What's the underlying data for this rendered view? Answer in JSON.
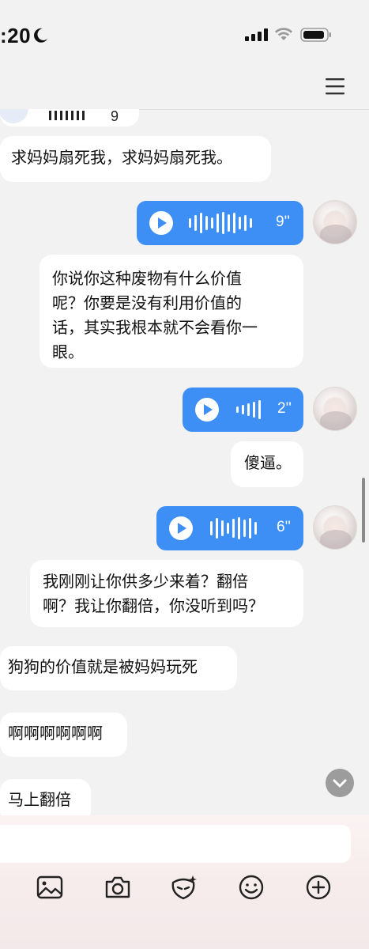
{
  "status_bar": {
    "time": ":20",
    "moon_icon": "moon-icon",
    "signal_icon": "signal-icon",
    "wifi_icon": "wifi-icon",
    "battery_icon": "battery-icon"
  },
  "header": {
    "menu_icon": "hamburger-menu-icon"
  },
  "messages": [
    {
      "side": "left",
      "type": "voice-partial",
      "duration": "9"
    },
    {
      "side": "left",
      "type": "text",
      "lines": [
        "求妈妈扇死我，求妈妈扇死我。"
      ]
    },
    {
      "side": "right",
      "type": "voice",
      "duration": "9''"
    },
    {
      "side": "right",
      "type": "text",
      "lines": [
        "你说你这种废物有什么价值",
        "呢？你要是没有利用价值的",
        "话，其实我根本就不会看你一",
        "眼。"
      ]
    },
    {
      "side": "right",
      "type": "voice",
      "duration": "2''"
    },
    {
      "side": "right",
      "type": "text",
      "lines": [
        "傻逼。"
      ]
    },
    {
      "side": "right",
      "type": "voice",
      "duration": "6''"
    },
    {
      "side": "right",
      "type": "text",
      "lines": [
        "我刚刚让你供多少来着？翻倍",
        "啊？我让你翻倍，你没听到吗？"
      ]
    },
    {
      "side": "left",
      "type": "text",
      "lines": [
        "狗狗的价值就是被妈妈玩死"
      ]
    },
    {
      "side": "left",
      "type": "text",
      "lines": [
        "啊啊啊啊啊啊"
      ]
    },
    {
      "side": "left",
      "type": "text",
      "lines": [
        "马上翻倍"
      ]
    }
  ],
  "toolbar": {
    "icons": [
      "image-icon",
      "camera-icon",
      "ai-assistant-icon",
      "emoji-icon",
      "add-icon"
    ]
  },
  "colors": {
    "voice_bubble": "#3d8ef5",
    "background": "#f2f2f2"
  }
}
